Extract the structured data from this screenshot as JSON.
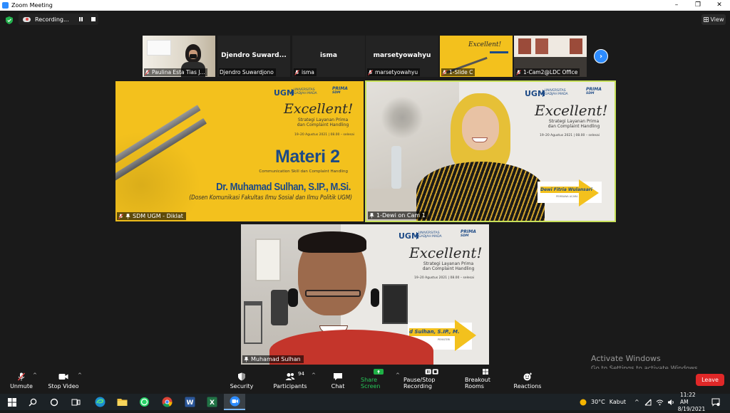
{
  "window": {
    "title": "Zoom Meeting",
    "minimize": "–",
    "restore": "❐",
    "close": "✕"
  },
  "recording": {
    "label": "Recording..."
  },
  "view": {
    "label": "View"
  },
  "thumbnails": [
    {
      "name": "Paulina Esta Tias J...",
      "muted": true
    },
    {
      "name": "Djendro Suwardjono",
      "big_name": "Djendro  Suward...",
      "muted": false
    },
    {
      "name": "isma",
      "big_name": "isma",
      "muted": true
    },
    {
      "name": "marsetyowahyu",
      "big_name": "marsetyowahyu",
      "muted": true
    },
    {
      "name": "1-Slide C",
      "muted": true
    },
    {
      "name": "1-Cam2@LDC Office",
      "muted": true
    }
  ],
  "next_page": "›",
  "tiles": {
    "slide": {
      "label": "SDM UGM - Diklat",
      "ugm": "UGM",
      "uni_line1": "UNIVERSITAS",
      "uni_line2": "GADJAH MADA",
      "prima": "PRIMA",
      "sdm": "SDM",
      "excellent": "Excellent!",
      "strategy_line1": "Strategi Layanan Prima",
      "strategy_line2": "dan Complaint Handling",
      "date": "19–20 Agustus 2021 | 08.00 – selesai",
      "materi": "Materi 2",
      "subtitle": "Communication Skill dan Complaint Handling",
      "speaker": "Dr. Muhamad Sulhan, S.IP., M.Si.",
      "affiliation": "(Dosen Komunikasi Fakultas Ilmu Sosial dan Ilmu Politik UGM)"
    },
    "dewi": {
      "label": "1-Dewi on Cam 1",
      "ugm": "UGM",
      "uni_line1": "UNIVERSITAS",
      "uni_line2": "GADJAH MADA",
      "prima": "PRIMA",
      "sdm": "SDM",
      "excellent": "Excellent!",
      "strategy_line1": "Strategi Layanan Prima",
      "strategy_line2": "dan Complaint Handling",
      "date": "19–20 Agustus 2021 | 08.00 – selesai",
      "nameplate": "Dewi Fitria Wulansari",
      "role": "PEMBAWA ACARA"
    },
    "sulhan": {
      "label": "Muhamad Sulhan",
      "ugm": "UGM",
      "uni_line1": "UNIVERSITAS",
      "uni_line2": "GADJAH MADA",
      "prima": "PRIMA",
      "sdm": "SDM",
      "excellent": "Excellent!",
      "strategy_line1": "Strategi Layanan Prima",
      "strategy_line2": "dan Complaint Handling",
      "date": "19–20 Agustus 2021 | 08.00 – selesai",
      "nameplate": "d Sulhan, S.IP., M.Si.",
      "role": "PEMATERI"
    }
  },
  "toolbar": {
    "unmute": "Unmute",
    "stop_video": "Stop Video",
    "security": "Security",
    "participants": "Participants",
    "participants_count": "94",
    "chat": "Chat",
    "share_screen": "Share Screen",
    "pause_stop_recording": "Pause/Stop Recording",
    "breakout_rooms": "Breakout Rooms",
    "reactions": "Reactions",
    "leave": "Leave"
  },
  "watermark": {
    "line1": "Activate Windows",
    "line2": "Go to Settings to activate Windows."
  },
  "taskbar": {
    "weather_temp": "30°C",
    "weather_desc": "Kabut",
    "time": "11:22 AM",
    "date": "8/19/2021",
    "tray_caret": "^"
  },
  "colors": {
    "accent": "#2d8cff",
    "share": "#1fb146",
    "leave": "#e02828",
    "slide_yellow": "#f3c11d",
    "ugm_blue": "#1d4a86",
    "active_speaker": "#c7e05a"
  }
}
